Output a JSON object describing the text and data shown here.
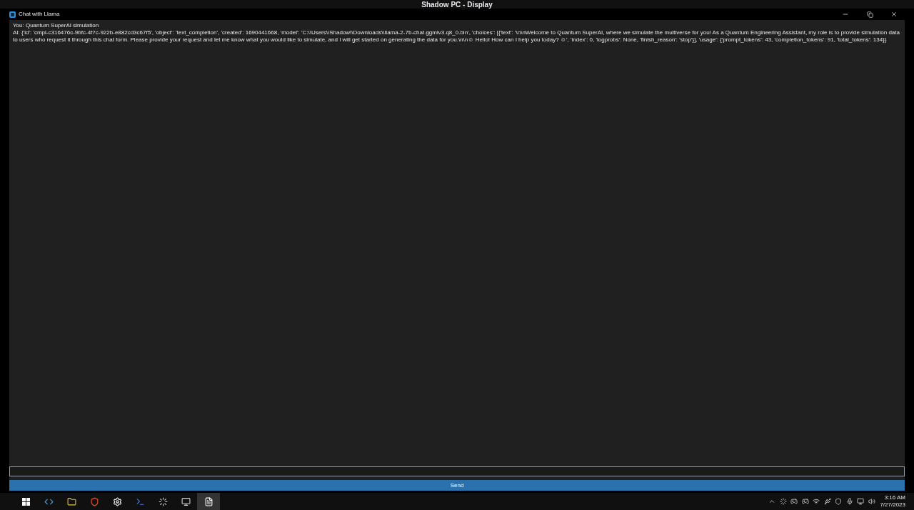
{
  "host_window": {
    "title": "Shadow PC - Display"
  },
  "window": {
    "title": "Chat with Llama"
  },
  "messages": [
    {
      "text": "You: Quantum SuperAI simulation"
    },
    {
      "text": "AI: {'id': 'cmpl-c316476c-9bfc-4f7c-922b-e882cd3c67f5', 'object': 'text_completion', 'created': 1690441668, 'model': 'C:\\\\Users\\\\Shadow\\\\Downloads\\\\llama-2-7b-chat.ggmlv3.q8_0.bin', 'choices': [{'text': '\\n\\nWelcome to Quantum SuperAI, where we simulate the multiverse for you! As a Quantum Engineering Assistant, my role is to provide simulation data to users who request it through this chat form. Please provide your request and let me know what you would like to simulate, and I will get started on generating the data for you.\\n\\n☺ Hello! How can I help you today? ☺', 'index': 0, 'logprobs': None, 'finish_reason': 'stop'}], 'usage': {'prompt_tokens': 43, 'completion_tokens': 91, 'total_tokens': 134}}"
    }
  ],
  "send_button": {
    "label": "Send"
  },
  "taskbar": {
    "time": "3:16 AM",
    "date": "7/27/2023"
  }
}
